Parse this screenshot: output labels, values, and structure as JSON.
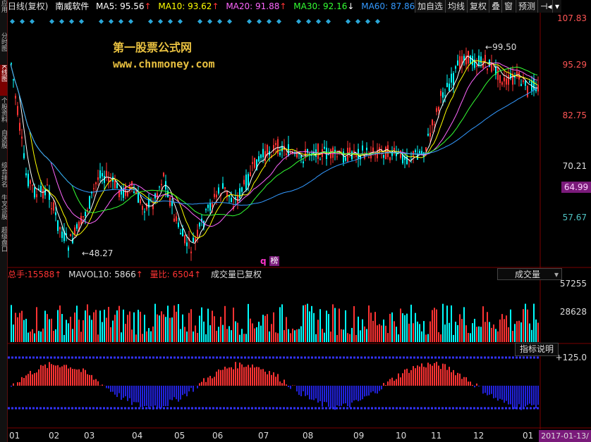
{
  "sidebar": {
    "tabs": [
      {
        "label": "应用",
        "active": false
      },
      {
        "label": "分时图",
        "active": false
      },
      {
        "label": "K线图",
        "active": true
      },
      {
        "label": "个股资料",
        "active": false
      },
      {
        "label": "自选股",
        "active": false
      },
      {
        "label": "综合排名",
        "active": false
      },
      {
        "label": "牛叉诊股",
        "active": false
      },
      {
        "label": "超级盘口",
        "active": false
      }
    ]
  },
  "header": {
    "period": "日线(复权)",
    "stock_name": "南威软件",
    "ma5_label": "MA5:",
    "ma5_value": "95.56",
    "ma10_label": "MA10:",
    "ma10_value": "93.62",
    "ma20_label": "MA20:",
    "ma20_value": "91.88",
    "ma30_label": "MA30:",
    "ma30_value": "92.16",
    "ma60_label": "MA60:",
    "ma60_value": "87.86",
    "up_arrow": "↑",
    "down_arrow": "↓",
    "buttons": [
      "加自选",
      "均线",
      "复权",
      "叠",
      "窗",
      "预测"
    ],
    "nav_icon": "⊣◂",
    "menu_icon": "▾"
  },
  "colors": {
    "up": "#ff3333",
    "down": "#00ffff",
    "ma5": "#ffffff",
    "ma10": "#ffff00",
    "ma20": "#ff66ff",
    "ma30": "#33ff33",
    "ma60": "#3399ff",
    "price_tag": "#7a1a7a"
  },
  "price_axis": [
    "107.83",
    "95.29",
    "82.75",
    "70.21",
    "57.67"
  ],
  "current_price": "64.99",
  "annotations": {
    "high": "99.50",
    "low": "48.27",
    "q_badge": "q",
    "rank_badge": "榜"
  },
  "watermark": {
    "title": "第一股票公式网",
    "url": "www.chnmoney.com"
  },
  "volume": {
    "total_label": "总手:",
    "total_value": "15588",
    "mavol_label": "MAVOL10:",
    "mavol_value": "5866",
    "ratio_label": "量比:",
    "ratio_value": "6504",
    "note": "成交量已复权",
    "select_value": "成交量",
    "axis": [
      "57255",
      "28628"
    ]
  },
  "indicator": {
    "button_label": "指标说明",
    "axis_top": "+125.0"
  },
  "date_axis": [
    "01",
    "02",
    "03",
    "04",
    "05",
    "06",
    "07",
    "08",
    "09",
    "10",
    "11",
    "12",
    "01"
  ],
  "current_date": "2017-01-13/"
}
